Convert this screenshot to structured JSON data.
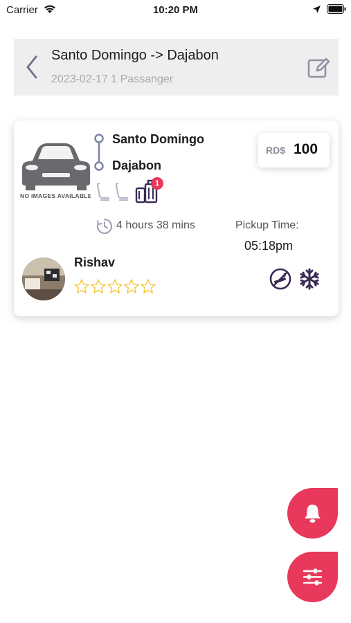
{
  "status_bar": {
    "carrier": "Carrier",
    "time": "10:20 PM"
  },
  "header": {
    "title": "Santo Domingo -> Dajabon",
    "subtitle": "2023-02-17 1 Passanger"
  },
  "ride_card": {
    "no_image_text": "NO IMAGES AVAILABLE",
    "from": "Santo Domingo",
    "to": "Dajabon",
    "luggage_count": "1",
    "price_currency": "RD$",
    "price_value": "100",
    "duration": "4 hours 38 mins",
    "pickup_label": "Pickup Time:",
    "pickup_time": "05:18pm",
    "driver_name": "Rishav",
    "rating_stars_total": 5,
    "rating_filled": 0,
    "amenities": [
      "no-smoking-icon",
      "air-conditioning-icon"
    ]
  },
  "colors": {
    "accent": "#e8385c",
    "icon_dark": "#3b2a55",
    "header_bg": "#eeeeef",
    "star": "#f4c430"
  }
}
